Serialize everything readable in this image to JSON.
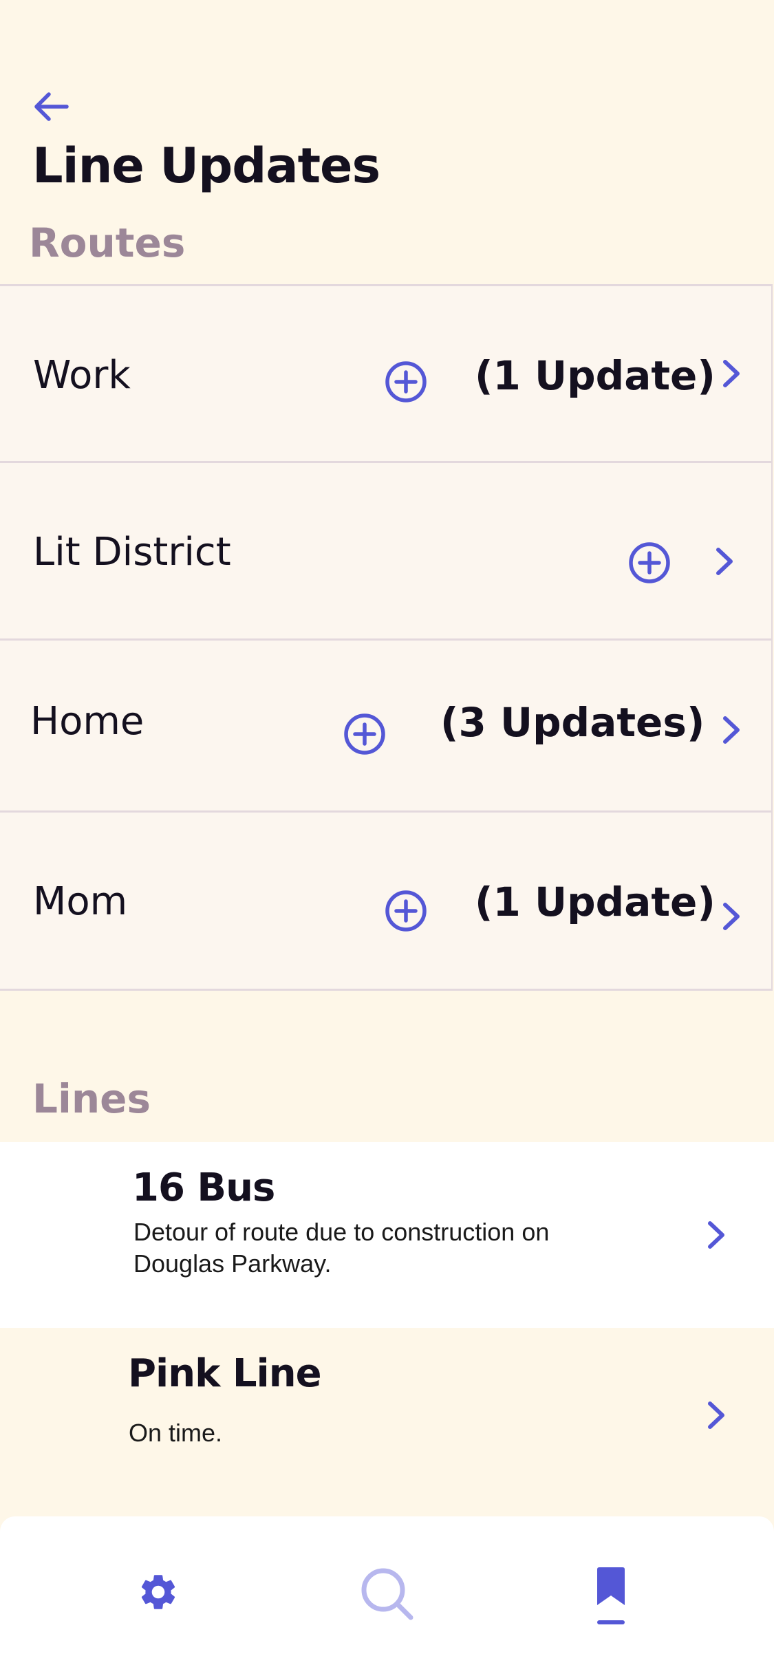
{
  "header": {
    "back_icon": "arrow-left-icon",
    "title": "Line Updates"
  },
  "routes": {
    "label": "Routes",
    "items": [
      {
        "name": "Work",
        "updates": "(1 Update)"
      },
      {
        "name": "Lit District",
        "updates": ""
      },
      {
        "name": "Home",
        "updates": "(3 Updates)"
      },
      {
        "name": "Mom",
        "updates": "(1 Update)"
      }
    ]
  },
  "lines": {
    "label": "Lines",
    "items": [
      {
        "name": "16 Bus",
        "status": "Detour of route due to construction on Douglas Parkway."
      },
      {
        "name": "Pink Line",
        "status": "On time."
      }
    ]
  },
  "nav": {
    "items": [
      {
        "icon": "gear-icon",
        "active": false
      },
      {
        "icon": "search-icon",
        "active": false
      },
      {
        "icon": "bookmark-icon",
        "active": true
      }
    ]
  },
  "colors": {
    "background": "#FEF7E8",
    "row_background": "#FCF6EF",
    "accent": "#5457D6",
    "accent_muted": "#B7B7EE",
    "section_label": "#9C8798",
    "text": "#14101F"
  }
}
